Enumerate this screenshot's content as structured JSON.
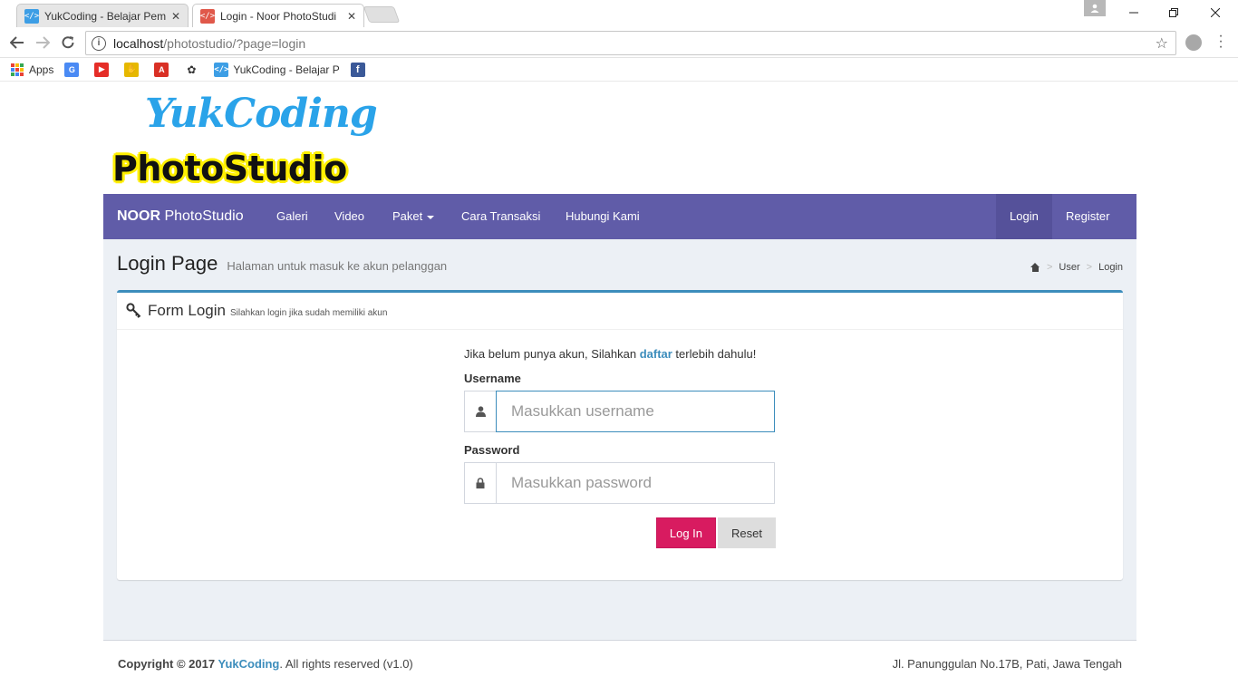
{
  "browser": {
    "tabs": [
      {
        "title": "YukCoding - Belajar Pem",
        "favicon_color": "#3d9ee5",
        "active": false
      },
      {
        "title": "Login - Noor PhotoStudi",
        "favicon_color": "#e0584a",
        "active": true
      }
    ],
    "url_host": "localhost",
    "url_path": "/photostudio/?page=login",
    "bookmarks": [
      {
        "label": "Apps",
        "icon": "apps-grid-icon"
      },
      {
        "label": "",
        "icon": "google-translate-icon",
        "color": "#4a8af4"
      },
      {
        "label": "",
        "icon": "youtube-icon",
        "color": "#e52d27"
      },
      {
        "label": "",
        "icon": "hand-icon",
        "color": "#e6b800"
      },
      {
        "label": "",
        "icon": "adobe-icon",
        "color": "#d93025"
      },
      {
        "label": "",
        "icon": "bee-icon",
        "color": "#333333"
      },
      {
        "label": "YukCoding - Belajar P",
        "icon": "yukcoding-icon",
        "color": "#3d9ee5"
      },
      {
        "label": "",
        "icon": "facebook-icon",
        "color": "#3b5998"
      }
    ]
  },
  "logo": {
    "top": "YukCoding",
    "bottom": "PhotoStudio"
  },
  "navbar": {
    "brand_bold": "NOOR",
    "brand_rest": " PhotoStudio",
    "items": [
      "Galeri",
      "Video",
      "Paket",
      "Cara Transaksi",
      "Hubungi Kami"
    ],
    "right_items": [
      "Login",
      "Register"
    ],
    "color": "#605ca8"
  },
  "header": {
    "title": "Login Page",
    "subtitle": "Halaman untuk masuk ke akun pelanggan",
    "breadcrumb": [
      "User",
      "Login"
    ]
  },
  "box": {
    "title": "Form Login",
    "subtitle": "Silahkan login jika sudah memiliki akun"
  },
  "form": {
    "notice_before": "Jika belum punya akun, Silahkan ",
    "notice_link": "daftar",
    "notice_after": " terlebih dahulu!",
    "username_label": "Username",
    "username_placeholder": "Masukkan username",
    "username_value": "",
    "password_label": "Password",
    "password_placeholder": "Masukkan password",
    "password_value": "",
    "login_button": "Log In",
    "reset_button": "Reset"
  },
  "footer": {
    "copyright_prefix": "Copyright © 2017 ",
    "copyright_link": "YukCoding",
    "copyright_suffix": ". All rights reserved (v1.0)",
    "address": "Jl. Panunggulan No.17B, Pati, Jawa Tengah"
  }
}
